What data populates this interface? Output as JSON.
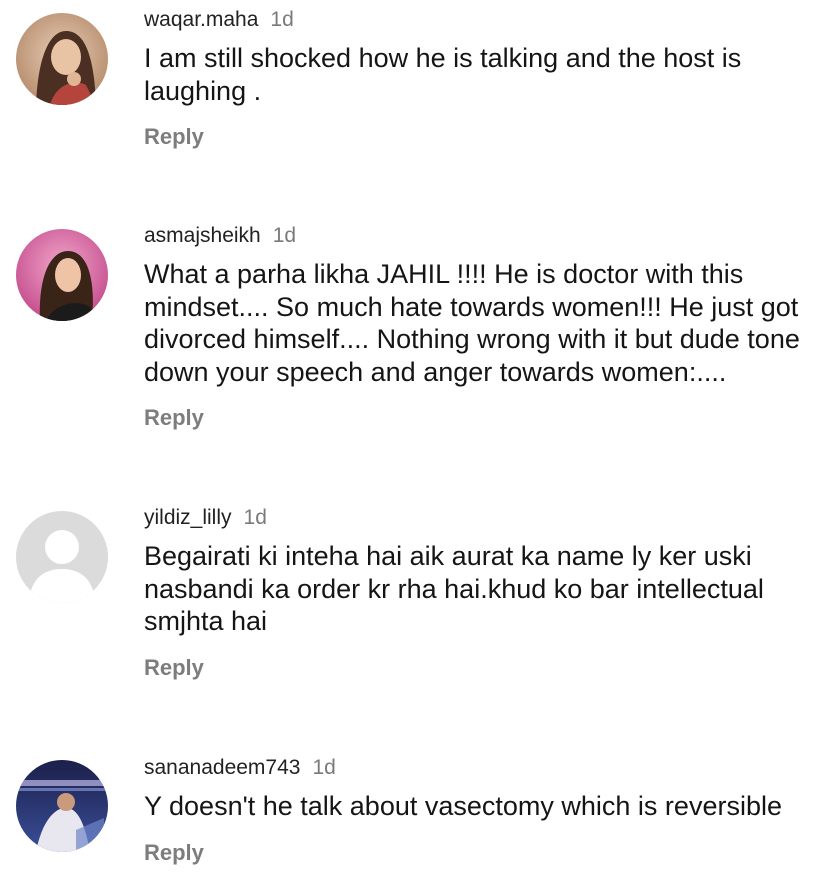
{
  "comments": [
    {
      "username": "waqar.maha",
      "time": "1d",
      "text": "I am still shocked how he is talking and the host is laughing .",
      "reply_label": "Reply",
      "avatar": "profile-photo"
    },
    {
      "username": "asmajsheikh",
      "time": "1d",
      "text": "What a parha likha JAHIL !!!! He is doctor with this mindset.... So much hate towards women!!! He just got divorced himself.... Nothing wrong with it but dude tone down your speech and anger towards women:....",
      "reply_label": "Reply",
      "avatar": "profile-photo"
    },
    {
      "username": "yildiz_lilly",
      "time": "1d",
      "text": "Begairati ki inteha hai aik aurat ka name ly ker uski nasbandi ka order kr rha hai.khud ko bar intellectual smjhta hai",
      "reply_label": "Reply",
      "avatar": "default-user-icon"
    },
    {
      "username": "sananadeem743",
      "time": "1d",
      "text": "Y doesn't he talk about vasectomy which is reversible",
      "reply_label": "Reply",
      "avatar": "profile-photo"
    }
  ]
}
